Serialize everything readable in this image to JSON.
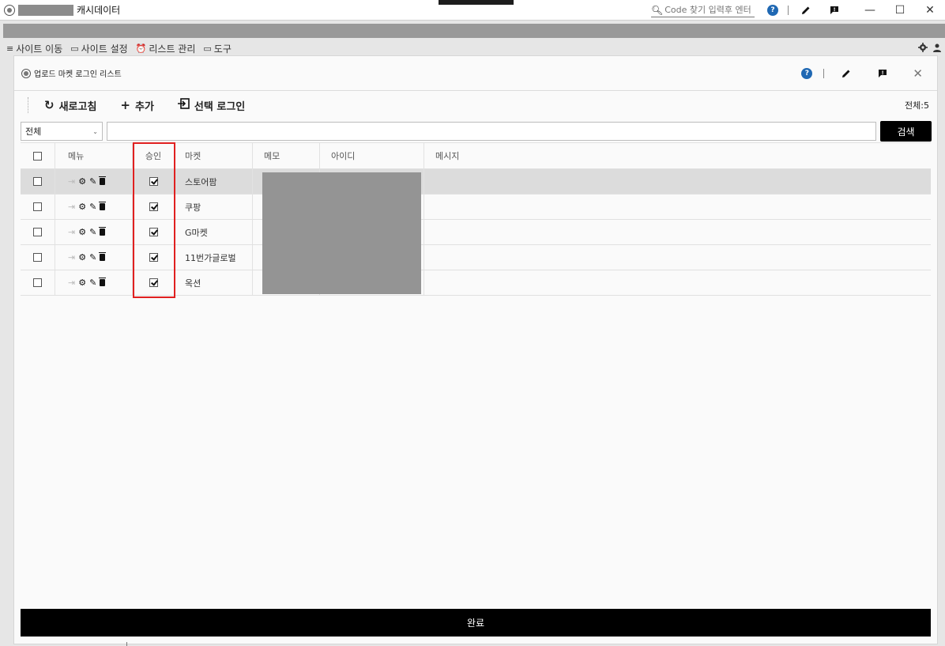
{
  "app": {
    "title": "캐시데이터"
  },
  "titlebar": {
    "search_placeholder": "Code 찾기 입력후 엔터",
    "help_label": "?",
    "minimize": "—",
    "maximize": "☐",
    "close": "✕"
  },
  "menu": {
    "items": [
      {
        "icon": "≡",
        "label": "사이트 이동"
      },
      {
        "icon": "▭",
        "label": "사이트 설정"
      },
      {
        "icon": "⏰",
        "label": "리스트 관리"
      },
      {
        "icon": "▭",
        "label": "도구"
      }
    ]
  },
  "modal": {
    "title": "업로드 마켓 로그인 리스트",
    "help_label": "?",
    "close": "✕"
  },
  "toolbar": {
    "refresh_label": "새로고침",
    "add_label": "추가",
    "select_login_label": "선택 로그인",
    "total": "전체:5"
  },
  "filter": {
    "select_value": "전체",
    "search_value": "",
    "search_button": "검색"
  },
  "table": {
    "headers": {
      "menu": "메뉴",
      "approval": "승인",
      "market": "마켓",
      "memo": "메모",
      "id": "아이디",
      "message": "메시지"
    },
    "rows": [
      {
        "market": "스토어팜",
        "approved": true,
        "selected": false
      },
      {
        "market": "쿠팡",
        "approved": true,
        "selected": false
      },
      {
        "market": "G마켓",
        "approved": true,
        "selected": false
      },
      {
        "market": "11번가글로벌",
        "approved": true,
        "selected": false
      },
      {
        "market": "옥션",
        "approved": true,
        "selected": false
      }
    ]
  },
  "footer": {
    "done_label": "완료"
  },
  "colors": {
    "highlight_border": "#e02020",
    "primary_button": "#000000",
    "help_badge": "#1f68b3"
  }
}
